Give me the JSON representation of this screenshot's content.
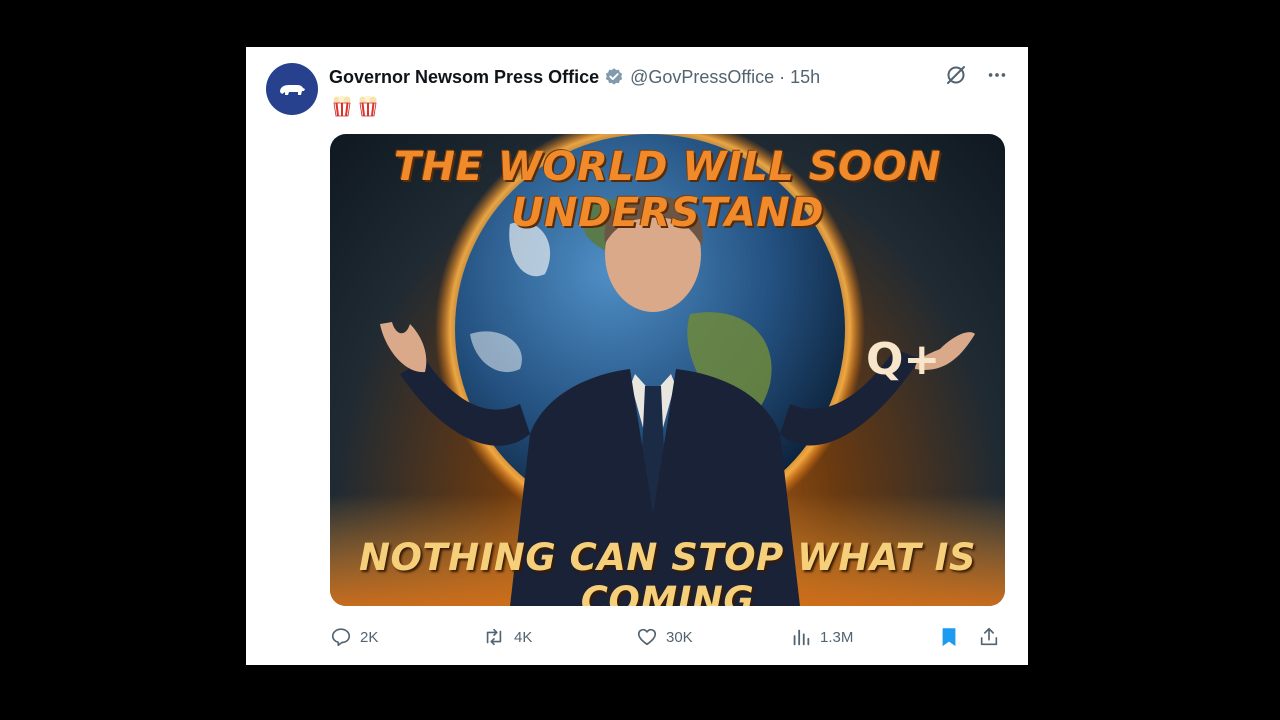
{
  "post": {
    "author_name": "Governor Newsom Press Office",
    "handle": "@GovPressOffice",
    "separator": "·",
    "time": "15h",
    "emoji": [
      "popcorn",
      "popcorn"
    ],
    "image_text_top": "THE WORLD WILL SOON UNDERSTAND",
    "image_text_bottom": "NOTHING CAN STOP WHAT IS COMING",
    "image_text_badge": "Q+"
  },
  "actions": {
    "replies": "2K",
    "reposts": "4K",
    "likes": "30K",
    "views": "1.3M"
  },
  "icons": {
    "avatar": "bear-flag-icon",
    "verified": "verified-badge-icon",
    "grok": "grok-icon",
    "more": "more-icon",
    "reply": "reply-icon",
    "repost": "repost-icon",
    "like": "heart-icon",
    "views": "views-icon",
    "bookmark": "bookmark-icon",
    "share": "share-icon"
  },
  "colors": {
    "avatar_bg": "#27418f",
    "bookmark_active": "#1d9bf0",
    "muted": "#536471"
  }
}
